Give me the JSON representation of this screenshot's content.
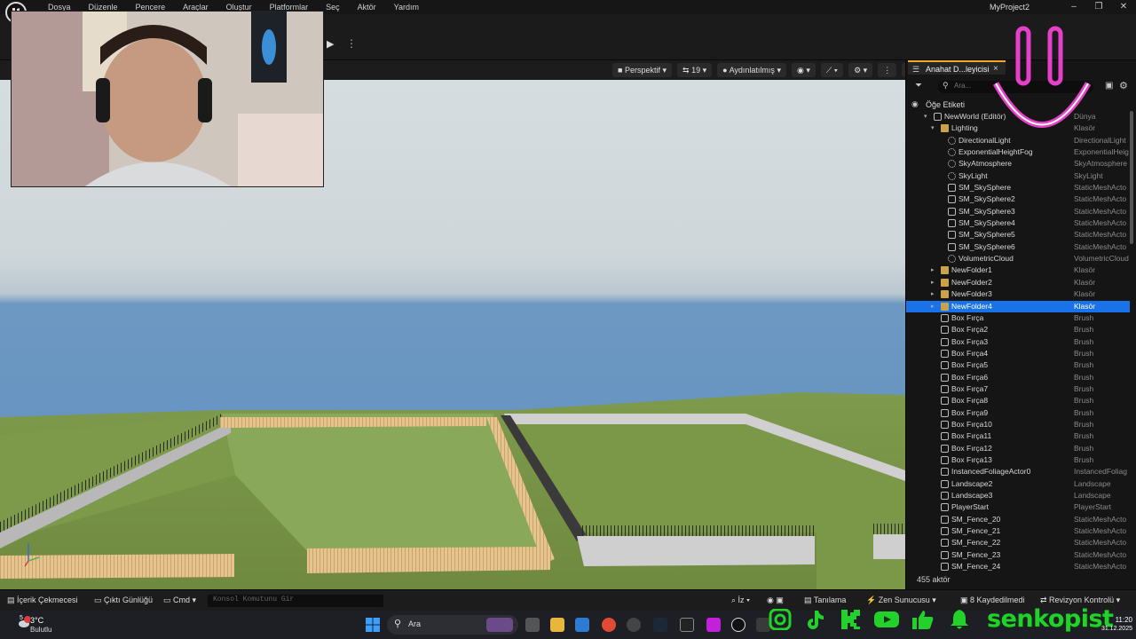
{
  "menu": [
    "Dosya",
    "Düzenle",
    "Pencere",
    "Araçlar",
    "Oluştur",
    "Platformlar",
    "Seç",
    "Aktör",
    "Yardım"
  ],
  "window": {
    "project_name": "MyProject2",
    "minimize": "–",
    "maximize": "❐",
    "close": "✕"
  },
  "viewport_toolbar": {
    "perspective": "Perspektif",
    "fov": "19",
    "lit": "Aydınlatılmış"
  },
  "outliner": {
    "tab_label": "Anahat D...leyicisi",
    "search_placeholder": "Ara...",
    "header": "Öğe Etiketi",
    "rows": [
      {
        "name": "NewWorld (Editör)",
        "type": "Dünya",
        "indent": 0,
        "icon": "world"
      },
      {
        "name": "Lighting",
        "type": "Klasör",
        "indent": 1,
        "icon": "folder"
      },
      {
        "name": "DirectionalLight",
        "type": "DirectionalLight",
        "indent": 2,
        "icon": "light"
      },
      {
        "name": "ExponentialHeightFog",
        "type": "ExponentialHeig",
        "indent": 2,
        "icon": "fog"
      },
      {
        "name": "SkyAtmosphere",
        "type": "SkyAtmosphere",
        "indent": 2,
        "icon": "sky"
      },
      {
        "name": "SkyLight",
        "type": "SkyLight",
        "indent": 2,
        "icon": "light"
      },
      {
        "name": "SM_SkySphere",
        "type": "StaticMeshActo",
        "indent": 2,
        "icon": "mesh"
      },
      {
        "name": "SM_SkySphere2",
        "type": "StaticMeshActo",
        "indent": 2,
        "icon": "mesh"
      },
      {
        "name": "SM_SkySphere3",
        "type": "StaticMeshActo",
        "indent": 2,
        "icon": "mesh"
      },
      {
        "name": "SM_SkySphere4",
        "type": "StaticMeshActo",
        "indent": 2,
        "icon": "mesh"
      },
      {
        "name": "SM_SkySphere5",
        "type": "StaticMeshActo",
        "indent": 2,
        "icon": "mesh"
      },
      {
        "name": "SM_SkySphere6",
        "type": "StaticMeshActo",
        "indent": 2,
        "icon": "mesh"
      },
      {
        "name": "VolumetricCloud",
        "type": "VolumetricCloud",
        "indent": 2,
        "icon": "cloud"
      },
      {
        "name": "NewFolder1",
        "type": "Klasör",
        "indent": 1,
        "icon": "folder"
      },
      {
        "name": "NewFolder2",
        "type": "Klasör",
        "indent": 1,
        "icon": "folder"
      },
      {
        "name": "NewFolder3",
        "type": "Klasör",
        "indent": 1,
        "icon": "folder"
      },
      {
        "name": "NewFolder4",
        "type": "Klasör",
        "indent": 1,
        "icon": "folder",
        "selected": true
      },
      {
        "name": "Box Fırça",
        "type": "Brush",
        "indent": 1,
        "icon": "brush"
      },
      {
        "name": "Box Fırça2",
        "type": "Brush",
        "indent": 1,
        "icon": "brush"
      },
      {
        "name": "Box Fırça3",
        "type": "Brush",
        "indent": 1,
        "icon": "brush"
      },
      {
        "name": "Box Fırça4",
        "type": "Brush",
        "indent": 1,
        "icon": "brush"
      },
      {
        "name": "Box Fırça5",
        "type": "Brush",
        "indent": 1,
        "icon": "brush"
      },
      {
        "name": "Box Fırça6",
        "type": "Brush",
        "indent": 1,
        "icon": "brush"
      },
      {
        "name": "Box Fırça7",
        "type": "Brush",
        "indent": 1,
        "icon": "brush"
      },
      {
        "name": "Box Fırça8",
        "type": "Brush",
        "indent": 1,
        "icon": "brush"
      },
      {
        "name": "Box Fırça9",
        "type": "Brush",
        "indent": 1,
        "icon": "brush"
      },
      {
        "name": "Box Fırça10",
        "type": "Brush",
        "indent": 1,
        "icon": "brush"
      },
      {
        "name": "Box Fırça11",
        "type": "Brush",
        "indent": 1,
        "icon": "brush"
      },
      {
        "name": "Box Fırça12",
        "type": "Brush",
        "indent": 1,
        "icon": "brush"
      },
      {
        "name": "Box Fırça13",
        "type": "Brush",
        "indent": 1,
        "icon": "brush"
      },
      {
        "name": "InstancedFoliageActor0",
        "type": "InstancedFoliag",
        "indent": 1,
        "icon": "foliage"
      },
      {
        "name": "Landscape2",
        "type": "Landscape",
        "indent": 1,
        "icon": "landscape"
      },
      {
        "name": "Landscape3",
        "type": "Landscape",
        "indent": 1,
        "icon": "landscape"
      },
      {
        "name": "PlayerStart",
        "type": "PlayerStart",
        "indent": 1,
        "icon": "player"
      },
      {
        "name": "SM_Fence_20",
        "type": "StaticMeshActo",
        "indent": 1,
        "icon": "mesh"
      },
      {
        "name": "SM_Fence_21",
        "type": "StaticMeshActo",
        "indent": 1,
        "icon": "mesh"
      },
      {
        "name": "SM_Fence_22",
        "type": "StaticMeshActo",
        "indent": 1,
        "icon": "mesh"
      },
      {
        "name": "SM_Fence_23",
        "type": "StaticMeshActo",
        "indent": 1,
        "icon": "mesh"
      },
      {
        "name": "SM_Fence_24",
        "type": "StaticMeshActo",
        "indent": 1,
        "icon": "mesh"
      }
    ],
    "actor_count": "455 aktör"
  },
  "bottombar": {
    "content_drawer": "İçerik Çekmecesi",
    "output_log": "Çıktı Günlüğü",
    "cmd": "Cmd",
    "cmd_placeholder": "Konsol Komutunu Gir",
    "trace": "İz",
    "diagnostics": "Tanılama",
    "zen": "Zen Sunucusu",
    "unsaved": "8 Kaydedilmedi",
    "revision": "Revizyon Kontrolü"
  },
  "taskbar": {
    "temperature": "3°C",
    "weather": "Bulutlu",
    "weather_badge": "5",
    "search": "Ara",
    "time": "11:20",
    "date": "31.12.2025"
  },
  "overlay": {
    "brand": "senkopist"
  },
  "colors": {
    "selection": "#1a72e8",
    "brand_green": "#22d22b",
    "overlay_pink": "#e640c8"
  }
}
